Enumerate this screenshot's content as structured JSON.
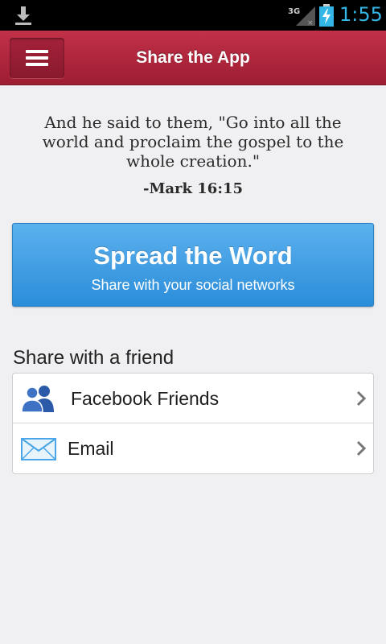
{
  "status_bar": {
    "time": "1:55",
    "network": "3G",
    "icons": [
      "download-icon",
      "signal-icon",
      "battery-charging-icon"
    ]
  },
  "app_bar": {
    "title": "Share the App",
    "menu_icon": "hamburger-menu-icon"
  },
  "verse": {
    "text": "And he said to them, \"Go into all the world and proclaim the gospel to the whole creation.\"",
    "reference": "-Mark 16:15"
  },
  "spread_button": {
    "title": "Spread the Word",
    "subtitle": "Share with your social networks"
  },
  "share_section": {
    "title": "Share with a friend",
    "items": [
      {
        "label": "Facebook Friends",
        "icon": "friends-icon"
      },
      {
        "label": "Email",
        "icon": "envelope-icon"
      }
    ]
  },
  "colors": {
    "app_bar": "#b02840",
    "button_blue": "#3a9be2",
    "status_accent": "#33b5e5",
    "background": "#f0eff1"
  }
}
